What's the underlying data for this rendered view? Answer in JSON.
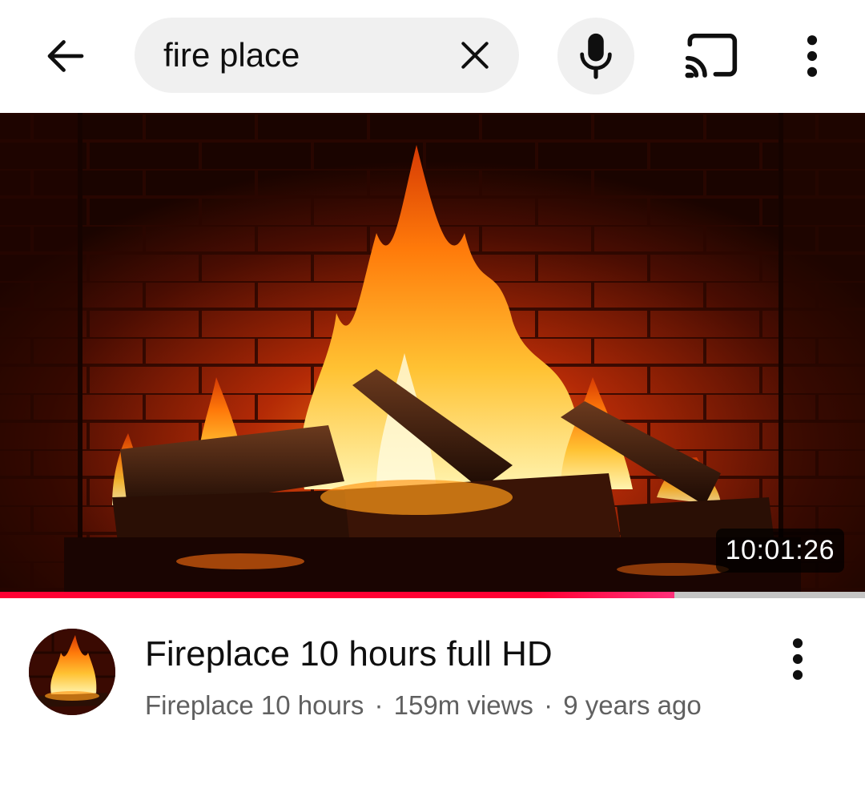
{
  "search": {
    "query": "fire place"
  },
  "icons": {
    "back": "arrow-left-icon",
    "clear": "close-icon",
    "mic": "microphone-icon",
    "cast": "cast-icon",
    "more": "more-vertical-icon"
  },
  "video": {
    "title": "Fireplace 10 hours full HD",
    "channel": "Fireplace 10 hours",
    "views": "159m views",
    "age": "9 years ago",
    "separator": "·",
    "duration": "10:01:26",
    "watch_progress_percent": 78
  },
  "colors": {
    "progress": "#ff0033",
    "search_bg": "#f0f0f0",
    "meta_text": "#606060"
  }
}
